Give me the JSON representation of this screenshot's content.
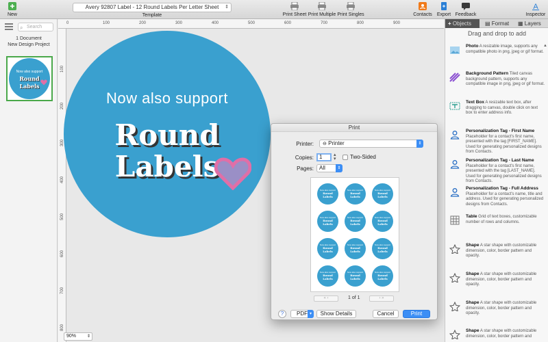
{
  "toolbar": {
    "new_label": "New",
    "template_value": "Avery 92807 Label - 12 Round Labels Per Letter Sheet",
    "template_label": "Template",
    "print_sheet": "Print Sheet",
    "print_multiple": "Print Multiple",
    "print_singles": "Print Singles",
    "contacts": "Contacts",
    "export": "Export",
    "feedback": "Feedback",
    "inspector": "Inspector",
    "colors": {
      "contacts": "#f07a1a",
      "export": "#2a7fd6",
      "feedback": "#3a3a3a"
    }
  },
  "docpanel": {
    "search_placeholder": "Search",
    "count_line1": "1 Document",
    "count_line2": "New Design Project",
    "thumb_line1": "Now also support",
    "thumb_line2": "Round",
    "thumb_line3": "Labels"
  },
  "canvas": {
    "line1": "Now also support",
    "line2": "Round",
    "line3": "Labels",
    "zoom": "90%",
    "circle_color": "#3aa0cf",
    "heart_color": "#e06fa7",
    "hruler_ticks": [
      "0",
      "100",
      "200",
      "300",
      "400",
      "500",
      "600",
      "700",
      "800",
      "900"
    ],
    "vruler_ticks": [
      "100",
      "200",
      "300",
      "400",
      "500",
      "600",
      "700",
      "800"
    ]
  },
  "print": {
    "title": "Print",
    "printer_label": "Printer:",
    "printer_value": "Printer",
    "copies_label": "Copies:",
    "copies_value": "1",
    "two_sided": "Two-Sided",
    "pages_label": "Pages:",
    "pages_value": "All",
    "mini_line1": "Now also support",
    "mini_line2": "Round",
    "mini_line3": "Labels",
    "page_indicator": "1 of 1",
    "pdf": "PDF",
    "show_details": "Show Details",
    "cancel": "Cancel",
    "print_btn": "Print",
    "help": "?"
  },
  "inspector": {
    "tabs": [
      "Objects",
      "Format",
      "Layers"
    ],
    "heading": "Drag and drop to add",
    "items": [
      {
        "title": "Photo",
        "desc": "A resizable image, supports any compatible photo in png, jpeg or gif format.",
        "icon": "photo-icon"
      },
      {
        "title": "Background Pattern",
        "desc": "Tiled canvas background pattern, supports any compatible image in png, jpeg or gif format.",
        "icon": "pattern-icon"
      },
      {
        "title": "Text Box",
        "desc": "A resizable text box, after dragging to canvas, double click on text box to enter address info.",
        "icon": "textbox-icon"
      },
      {
        "title": "Personalization Tag - First Name",
        "desc": "Placeholder for a contact's first name, presented with the tag [FIRST_NAME]. Used for generating personalized designs from Contacts.",
        "icon": "person-icon"
      },
      {
        "title": "Personalization Tag - Last Name",
        "desc": "Placeholder for a contact's first name, presented with the tag [LAST_NAME]. Used for generating personalized designs from Contacts.",
        "icon": "person-icon"
      },
      {
        "title": "Personalization Tag - Full Address",
        "desc": "Placeholder for a contact's name, title and address. Used for generating personalized designs from Contacts.",
        "icon": "person-icon"
      },
      {
        "title": "Table",
        "desc": "Grid of text boxes, customizable number of rows and columns.",
        "icon": "table-icon"
      },
      {
        "title": "Shape",
        "desc": "A star shape with customizable dimension, color, border pattern and opacity.",
        "icon": "star-icon"
      },
      {
        "title": "Shape",
        "desc": "A star shape with customizable dimension, color, border pattern and opacity.",
        "icon": "star-icon"
      },
      {
        "title": "Shape",
        "desc": "A star shape with customizable dimension, color, border pattern and opacity.",
        "icon": "star-icon"
      },
      {
        "title": "Shape",
        "desc": "A star shape with customizable dimension, color, border pattern and",
        "icon": "star-icon"
      }
    ]
  }
}
